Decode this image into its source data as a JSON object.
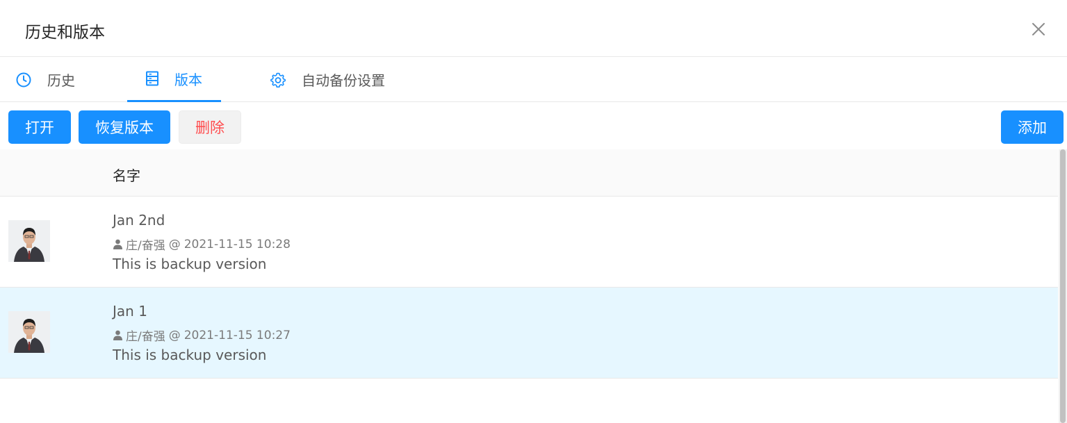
{
  "dialog": {
    "title": "历史和版本",
    "close_icon": "close-icon"
  },
  "tabs": [
    {
      "label": "历史",
      "icon": "clock-icon",
      "active": false
    },
    {
      "label": "版本",
      "icon": "server-icon",
      "active": true
    },
    {
      "label": "自动备份设置",
      "icon": "gear-icon",
      "active": false
    }
  ],
  "toolbar": {
    "open_label": "打开",
    "restore_label": "恢复版本",
    "delete_label": "删除",
    "add_label": "添加"
  },
  "table": {
    "columns": [
      "名字"
    ],
    "rows": [
      {
        "name": "Jan 2nd",
        "user": "庄/奋强",
        "at": "@",
        "timestamp": "2021-11-15 10:28",
        "description": "This is backup version",
        "selected": false
      },
      {
        "name": "Jan 1",
        "user": "庄/奋强",
        "at": "@",
        "timestamp": "2021-11-15 10:27",
        "description": "This is backup version",
        "selected": true
      }
    ]
  },
  "colors": {
    "primary": "#1890ff",
    "danger": "#ff4d4f",
    "selected_row": "#e6f7ff"
  }
}
